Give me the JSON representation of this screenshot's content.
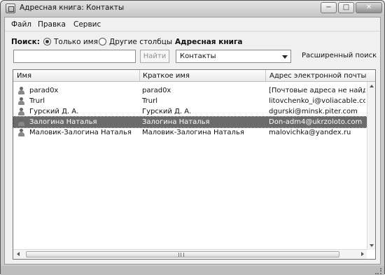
{
  "window": {
    "title": "Адресная книга: Контакты",
    "minimize": "−",
    "maximize": "□",
    "close": "✕"
  },
  "menu": [
    "Файл",
    "Правка",
    "Сервис"
  ],
  "search": {
    "label": "Поиск:",
    "options": [
      "Только имя",
      "Другие столбцы"
    ],
    "selected_option": "Только имя",
    "input_value": "",
    "find_button": "Найти",
    "address_book_label": "Адресная книга",
    "address_book_value": "Контакты",
    "advanced_search": "Расширенный поиск"
  },
  "table": {
    "columns": [
      "Имя",
      "Краткое имя",
      "Адрес электронной почты"
    ],
    "rows": [
      {
        "name": "parad0x",
        "short": "parad0x",
        "email": "[Почтовые адреса не найден"
      },
      {
        "name": "Trurl",
        "short": "Trurl",
        "email": "litovchenko_i@voliacable.com"
      },
      {
        "name": "Гурский Д. А.",
        "short": "Гурский Д. А.",
        "email": "dgurski@minsk.piter.com"
      },
      {
        "name": "Залогина Наталья",
        "short": "Залогина Наталья",
        "email": "Don-adm4@ukrzoloto.com",
        "selected": true
      },
      {
        "name": "Маловик-Залогина Наталья",
        "short": "Маловик-Залогина Наталья",
        "email": "malovichka@yandex.ru"
      }
    ],
    "selected_row": "Залогина Наталья",
    "icons": {
      "contact": "person-icon",
      "scroll_up": "up-arrow-icon",
      "scroll_down": "down-arrow-icon",
      "scroll_left": "left-arrow-icon",
      "scroll_right": "right-arrow-icon"
    }
  },
  "colors": {
    "selection": "#6b6b6b",
    "window_frame": "#c9c9c9"
  }
}
